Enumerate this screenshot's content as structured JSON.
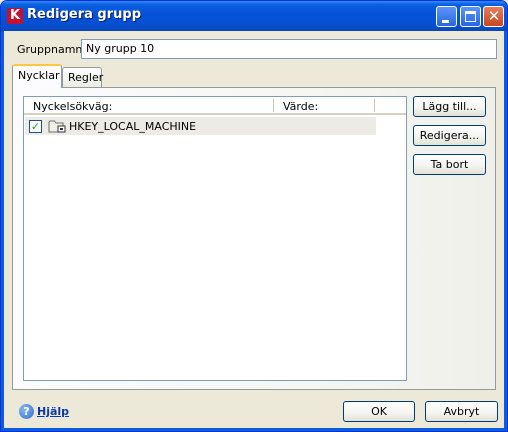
{
  "window": {
    "title": "Redigera grupp",
    "app_icon_glyph": "K"
  },
  "titlebar_buttons": {
    "minimize": "minimize-icon",
    "maximize": "maximize-icon",
    "close_glyph": "✕"
  },
  "group": {
    "label": "Gruppnamn:",
    "value": "Ny grupp 10"
  },
  "tabs": [
    {
      "label": "Nycklar",
      "active": true
    },
    {
      "label": "Regler",
      "active": false
    }
  ],
  "list": {
    "columns": [
      "Nyckelsökväg:",
      "Värde:"
    ],
    "rows": [
      {
        "checked": true,
        "check_glyph": "✓",
        "icon": "registry-folder-icon",
        "path": "HKEY_LOCAL_MACHINE",
        "value": ""
      }
    ]
  },
  "side_buttons": {
    "add": "Lägg till...",
    "edit": "Redigera...",
    "remove": "Ta bort"
  },
  "footer": {
    "help_glyph": "?",
    "help_label": "Hjälp",
    "ok_label": "OK",
    "cancel_label": "Avbryt"
  },
  "colors": {
    "titlebar": "#0753d8",
    "dialog_bg": "#ece9d8",
    "active_tab_accent": "#ffc83c",
    "help_link": "#0b3aa8"
  }
}
